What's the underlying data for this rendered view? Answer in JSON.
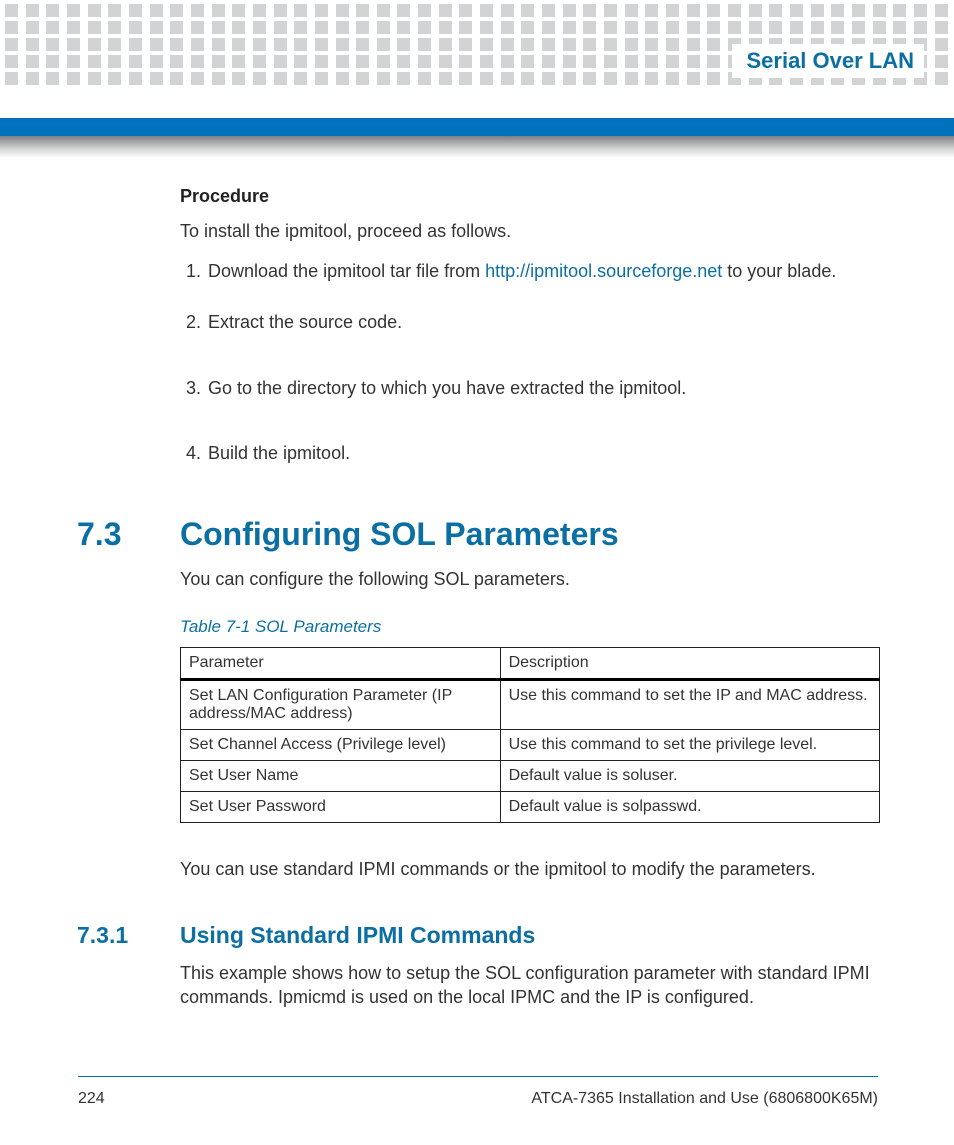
{
  "header": {
    "chapter_title": "Serial Over LAN"
  },
  "procedure": {
    "heading": "Procedure",
    "intro": "To install the ipmitool, proceed as follows.",
    "steps": [
      {
        "pre": "Download the ipmitool tar file from ",
        "link_text": "http://ipmitool.sourceforge.net",
        "post": " to your blade."
      },
      {
        "pre": "Extract the source code."
      },
      {
        "pre": "Go to the directory to which you have extracted the ipmitool."
      },
      {
        "pre": "Build the ipmitool."
      }
    ]
  },
  "section": {
    "number": "7.3",
    "title": "Configuring SOL Parameters",
    "intro": "You can configure the following SOL parameters.",
    "table_caption": "Table 7-1 SOL Parameters",
    "table": {
      "headers": [
        "Parameter",
        "Description"
      ],
      "rows": [
        [
          "Set LAN Configuration Parameter (IP address/MAC address)",
          "Use this command to set the IP and MAC address."
        ],
        [
          "Set Channel Access (Privilege level)",
          "Use this command to set the privilege level."
        ],
        [
          "Set User Name",
          "Default value is soluser."
        ],
        [
          "Set User Password",
          "Default value is solpasswd."
        ]
      ]
    },
    "outro": "You can use standard IPMI commands or the ipmitool to modify the parameters."
  },
  "subsection": {
    "number": "7.3.1",
    "title": "Using Standard IPMI Commands",
    "body": "This example shows how to setup the SOL configuration parameter with standard IPMI commands. Ipmicmd is used on the local IPMC and the IP is configured."
  },
  "footer": {
    "page": "224",
    "doc": "ATCA-7365 Installation and Use (6806800K65M)"
  },
  "chart_data": null
}
